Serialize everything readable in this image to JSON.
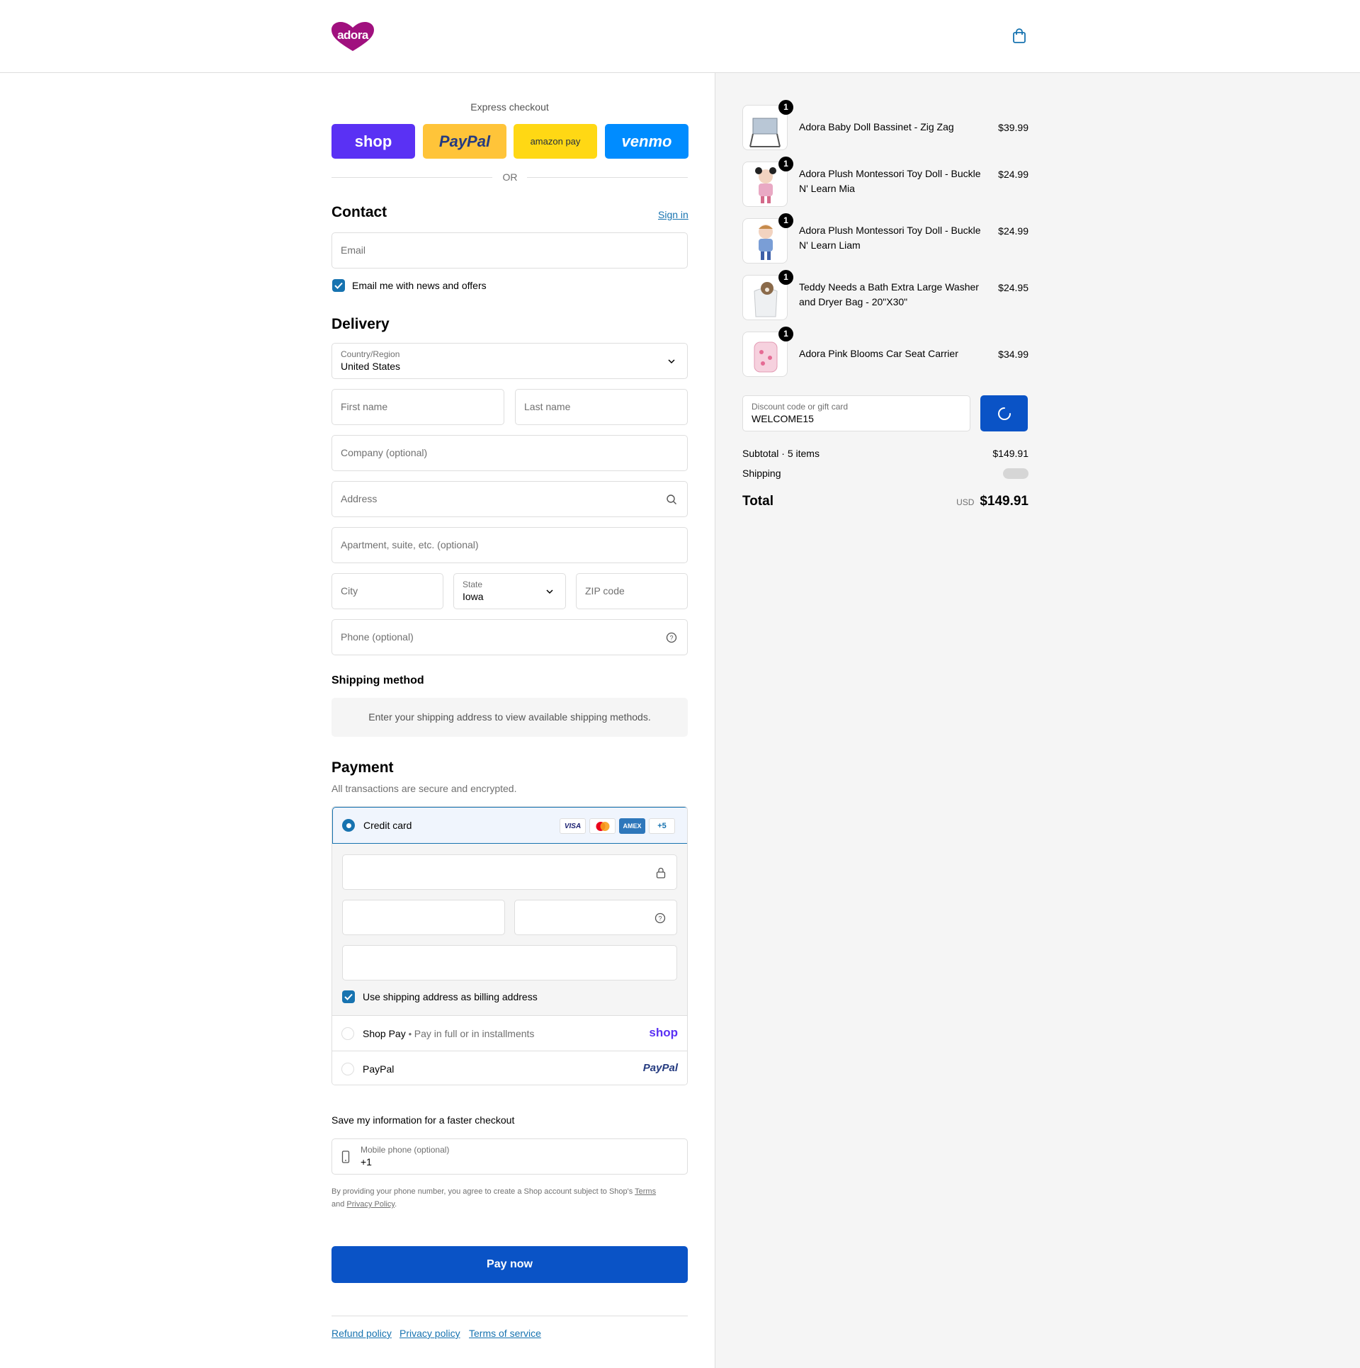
{
  "header": {
    "brand": "adora",
    "cart_icon": "shopping-bag-icon"
  },
  "express": {
    "title": "Express checkout",
    "buttons": [
      {
        "label": "shop",
        "color": "#5a31f4"
      },
      {
        "label": "PayPal",
        "color": "#ffc439"
      },
      {
        "label": "amazon pay",
        "color": "#ffd814"
      },
      {
        "label": "venmo",
        "color": "#008cff"
      }
    ],
    "or": "OR"
  },
  "contact": {
    "heading": "Contact",
    "sign_in": "Sign in",
    "email_placeholder": "Email",
    "news_label": "Email me with news and offers"
  },
  "delivery": {
    "heading": "Delivery",
    "country_label": "Country/Region",
    "country_value": "United States",
    "first_name": "First name",
    "last_name": "Last name",
    "company": "Company (optional)",
    "address": "Address",
    "apartment": "Apartment, suite, etc. (optional)",
    "city": "City",
    "state_label": "State",
    "state_value": "Iowa",
    "zip": "ZIP code",
    "phone": "Phone (optional)"
  },
  "shipping_method": {
    "heading": "Shipping method",
    "message": "Enter your shipping address to view available shipping methods."
  },
  "payment": {
    "heading": "Payment",
    "subtitle": "All transactions are secure and encrypted.",
    "credit_card_label": "Credit card",
    "card_badges": [
      "VISA",
      "",
      "AMEX",
      "+5"
    ],
    "billing_label": "Use shipping address as billing address",
    "shop_pay_label": "Shop Pay",
    "shop_pay_sub": "Pay in full or in installments",
    "shop_pay_logo": "shop",
    "paypal_label": "PayPal",
    "paypal_logo": "PayPal"
  },
  "save_info": {
    "heading": "Save my information for a faster checkout",
    "mobile_label": "Mobile phone (optional)",
    "mobile_value": "+1",
    "legal_prefix": "By providing your phone number, you agree to create a Shop account subject to Shop's",
    "terms": "Terms",
    "and": "and",
    "privacy": "Privacy Policy",
    "period": "."
  },
  "pay_now": "Pay now",
  "footer_links": [
    "Refund policy",
    "Privacy policy",
    "Terms of service"
  ],
  "order": {
    "items": [
      {
        "name": "Adora Baby Doll Bassinet - Zig Zag",
        "price": "$39.99",
        "qty": "1"
      },
      {
        "name": "Adora Plush Montessori Toy Doll - Buckle N' Learn Mia",
        "price": "$24.99",
        "qty": "1"
      },
      {
        "name": "Adora Plush Montessori Toy Doll - Buckle N' Learn Liam",
        "price": "$24.99",
        "qty": "1"
      },
      {
        "name": "Teddy Needs a Bath Extra Large Washer and Dryer Bag - 20\"X30\"",
        "price": "$24.95",
        "qty": "1"
      },
      {
        "name": "Adora Pink Blooms Car Seat Carrier",
        "price": "$34.99",
        "qty": "1"
      }
    ],
    "discount_label": "Discount code or gift card",
    "discount_value": "WELCOME15",
    "subtotal_label": "Subtotal · 5 items",
    "subtotal_value": "$149.91",
    "shipping_label": "Shipping",
    "total_label": "Total",
    "currency": "USD",
    "total_value": "$149.91"
  },
  "colors": {
    "accent": "#1773b0",
    "button": "#0a53c6",
    "brand": "#a0107e"
  }
}
